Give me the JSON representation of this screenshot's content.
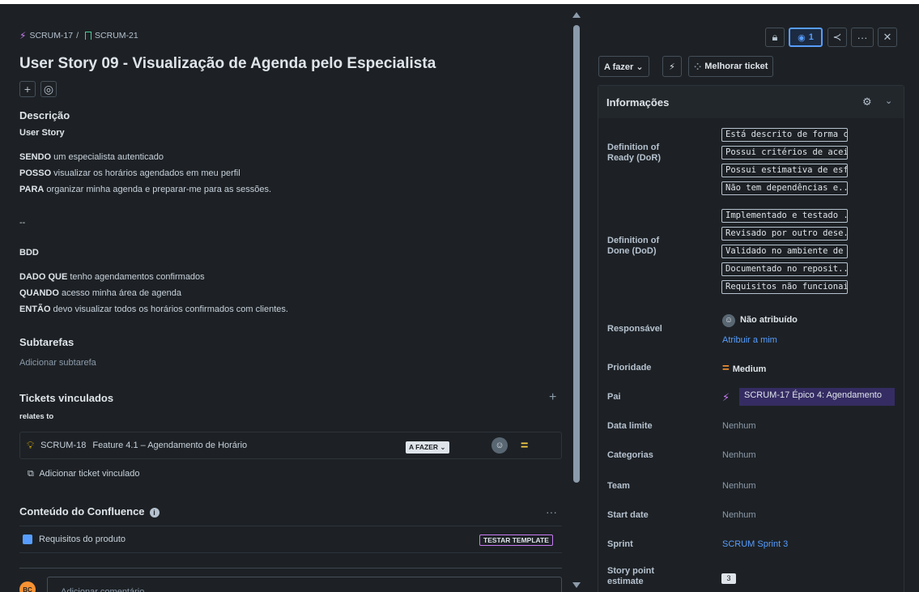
{
  "breadcrumb": {
    "epic": "SCRUM-17",
    "separator": "/",
    "story": "SCRUM-21"
  },
  "title": "User Story 09 - Visualização de Agenda pelo Especialista",
  "description": {
    "heading": "Descrição",
    "subheading": "User Story",
    "lines": [
      {
        "kw": "SENDO",
        "text": " um especialista autenticado"
      },
      {
        "kw": "POSSO",
        "text": " visualizar os horários agendados em meu perfil"
      },
      {
        "kw": "PARA",
        "text": " organizar minha agenda e preparar-me para as sessões."
      }
    ],
    "separator": "--",
    "bdd_heading": "BDD",
    "bdd": [
      {
        "kw": "DADO QUE",
        "text": " tenho agendamentos confirmados"
      },
      {
        "kw": "QUANDO",
        "text": " acesso minha área de agenda"
      },
      {
        "kw": "ENTÃO",
        "text": " devo visualizar todos os horários confirmados com clientes."
      }
    ]
  },
  "subtasks": {
    "heading": "Subtarefas",
    "add": "Adicionar subtarefa"
  },
  "linked": {
    "heading": "Tickets vinculados",
    "relation": "relates to",
    "item": {
      "key": "SCRUM-18",
      "summary": "Feature 4.1 – Agendamento de Horário",
      "status": "A FAZER ⌄"
    },
    "add": "Adicionar ticket vinculado"
  },
  "confluence": {
    "heading": "Conteúdo do Confluence",
    "more": "···",
    "item": "Requisitos do produto",
    "badge": "TESTAR TEMPLATE"
  },
  "comment": {
    "avatar": "BC",
    "placeholder": "Adicionar comentário..."
  },
  "toolbar": {
    "watch_count": "1",
    "more": "···",
    "close": "✕"
  },
  "status": {
    "label": "A fazer ⌄",
    "improve": "Melhorar ticket"
  },
  "info": {
    "heading": "Informações",
    "dor_label": "Definition of Ready (DoR)",
    "dor": [
      "Está descrito de forma cl...",
      "Possui critérios de aceita...",
      "Possui estimativa de esf...",
      "Não tem dependências e..."
    ],
    "dod_label": "Definition of Done (DoD)",
    "dod": [
      "Implementado e testado ...",
      "Revisado por outro dese...",
      "Validado no ambiente de ...",
      "Documentado no reposit...",
      "Requisitos não funcionai..."
    ],
    "assignee_label": "Responsável",
    "assignee": "Não atribuído",
    "assign_me": "Atribuir a mim",
    "priority_label": "Prioridade",
    "priority": "Medium",
    "parent_label": "Pai",
    "parent": "SCRUM-17 Épico 4: Agendamento",
    "due_label": "Data limite",
    "due": "Nenhum",
    "categories_label": "Categorias",
    "categories": "Nenhum",
    "team_label": "Team",
    "team": "Nenhum",
    "start_label": "Start date",
    "start": "Nenhum",
    "sprint_label": "Sprint",
    "sprint": "SCRUM Sprint 3",
    "sp_label": "Story point estimate",
    "sp": "3"
  }
}
